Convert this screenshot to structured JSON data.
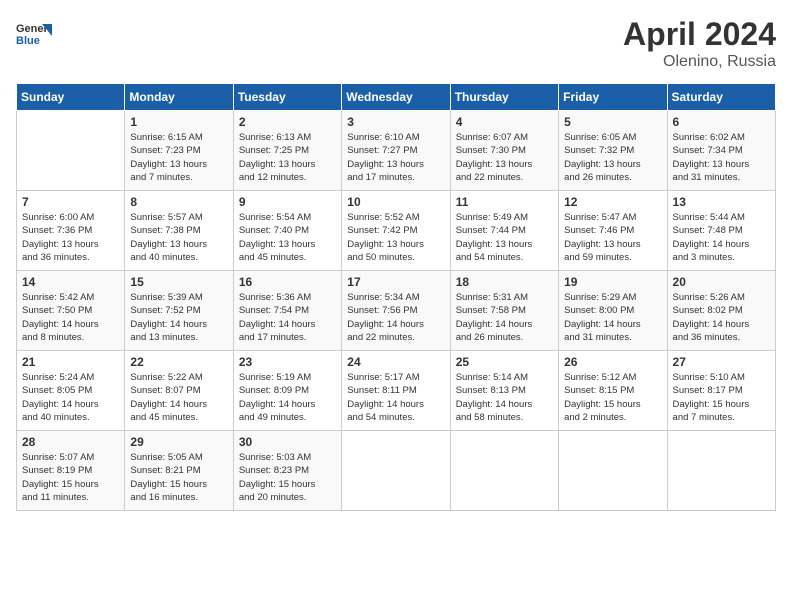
{
  "header": {
    "logo_line1": "General",
    "logo_line2": "Blue",
    "month_year": "April 2024",
    "location": "Olenino, Russia"
  },
  "days_of_week": [
    "Sunday",
    "Monday",
    "Tuesday",
    "Wednesday",
    "Thursday",
    "Friday",
    "Saturday"
  ],
  "weeks": [
    [
      {
        "day": "",
        "info": ""
      },
      {
        "day": "1",
        "info": "Sunrise: 6:15 AM\nSunset: 7:23 PM\nDaylight: 13 hours\nand 7 minutes."
      },
      {
        "day": "2",
        "info": "Sunrise: 6:13 AM\nSunset: 7:25 PM\nDaylight: 13 hours\nand 12 minutes."
      },
      {
        "day": "3",
        "info": "Sunrise: 6:10 AM\nSunset: 7:27 PM\nDaylight: 13 hours\nand 17 minutes."
      },
      {
        "day": "4",
        "info": "Sunrise: 6:07 AM\nSunset: 7:30 PM\nDaylight: 13 hours\nand 22 minutes."
      },
      {
        "day": "5",
        "info": "Sunrise: 6:05 AM\nSunset: 7:32 PM\nDaylight: 13 hours\nand 26 minutes."
      },
      {
        "day": "6",
        "info": "Sunrise: 6:02 AM\nSunset: 7:34 PM\nDaylight: 13 hours\nand 31 minutes."
      }
    ],
    [
      {
        "day": "7",
        "info": "Sunrise: 6:00 AM\nSunset: 7:36 PM\nDaylight: 13 hours\nand 36 minutes."
      },
      {
        "day": "8",
        "info": "Sunrise: 5:57 AM\nSunset: 7:38 PM\nDaylight: 13 hours\nand 40 minutes."
      },
      {
        "day": "9",
        "info": "Sunrise: 5:54 AM\nSunset: 7:40 PM\nDaylight: 13 hours\nand 45 minutes."
      },
      {
        "day": "10",
        "info": "Sunrise: 5:52 AM\nSunset: 7:42 PM\nDaylight: 13 hours\nand 50 minutes."
      },
      {
        "day": "11",
        "info": "Sunrise: 5:49 AM\nSunset: 7:44 PM\nDaylight: 13 hours\nand 54 minutes."
      },
      {
        "day": "12",
        "info": "Sunrise: 5:47 AM\nSunset: 7:46 PM\nDaylight: 13 hours\nand 59 minutes."
      },
      {
        "day": "13",
        "info": "Sunrise: 5:44 AM\nSunset: 7:48 PM\nDaylight: 14 hours\nand 3 minutes."
      }
    ],
    [
      {
        "day": "14",
        "info": "Sunrise: 5:42 AM\nSunset: 7:50 PM\nDaylight: 14 hours\nand 8 minutes."
      },
      {
        "day": "15",
        "info": "Sunrise: 5:39 AM\nSunset: 7:52 PM\nDaylight: 14 hours\nand 13 minutes."
      },
      {
        "day": "16",
        "info": "Sunrise: 5:36 AM\nSunset: 7:54 PM\nDaylight: 14 hours\nand 17 minutes."
      },
      {
        "day": "17",
        "info": "Sunrise: 5:34 AM\nSunset: 7:56 PM\nDaylight: 14 hours\nand 22 minutes."
      },
      {
        "day": "18",
        "info": "Sunrise: 5:31 AM\nSunset: 7:58 PM\nDaylight: 14 hours\nand 26 minutes."
      },
      {
        "day": "19",
        "info": "Sunrise: 5:29 AM\nSunset: 8:00 PM\nDaylight: 14 hours\nand 31 minutes."
      },
      {
        "day": "20",
        "info": "Sunrise: 5:26 AM\nSunset: 8:02 PM\nDaylight: 14 hours\nand 36 minutes."
      }
    ],
    [
      {
        "day": "21",
        "info": "Sunrise: 5:24 AM\nSunset: 8:05 PM\nDaylight: 14 hours\nand 40 minutes."
      },
      {
        "day": "22",
        "info": "Sunrise: 5:22 AM\nSunset: 8:07 PM\nDaylight: 14 hours\nand 45 minutes."
      },
      {
        "day": "23",
        "info": "Sunrise: 5:19 AM\nSunset: 8:09 PM\nDaylight: 14 hours\nand 49 minutes."
      },
      {
        "day": "24",
        "info": "Sunrise: 5:17 AM\nSunset: 8:11 PM\nDaylight: 14 hours\nand 54 minutes."
      },
      {
        "day": "25",
        "info": "Sunrise: 5:14 AM\nSunset: 8:13 PM\nDaylight: 14 hours\nand 58 minutes."
      },
      {
        "day": "26",
        "info": "Sunrise: 5:12 AM\nSunset: 8:15 PM\nDaylight: 15 hours\nand 2 minutes."
      },
      {
        "day": "27",
        "info": "Sunrise: 5:10 AM\nSunset: 8:17 PM\nDaylight: 15 hours\nand 7 minutes."
      }
    ],
    [
      {
        "day": "28",
        "info": "Sunrise: 5:07 AM\nSunset: 8:19 PM\nDaylight: 15 hours\nand 11 minutes."
      },
      {
        "day": "29",
        "info": "Sunrise: 5:05 AM\nSunset: 8:21 PM\nDaylight: 15 hours\nand 16 minutes."
      },
      {
        "day": "30",
        "info": "Sunrise: 5:03 AM\nSunset: 8:23 PM\nDaylight: 15 hours\nand 20 minutes."
      },
      {
        "day": "",
        "info": ""
      },
      {
        "day": "",
        "info": ""
      },
      {
        "day": "",
        "info": ""
      },
      {
        "day": "",
        "info": ""
      }
    ]
  ]
}
